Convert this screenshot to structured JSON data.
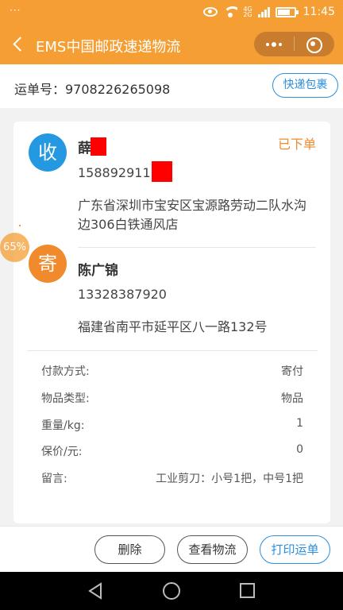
{
  "status_bar": {
    "dots": "···",
    "net_top": "4G",
    "net_bottom": "2G",
    "time": "11:45"
  },
  "titlebar": {
    "title": "EMS中国邮政速递物流"
  },
  "waybill": {
    "text": "运单号：9708226265098",
    "button": "快递包裹"
  },
  "receiver": {
    "avatar": "收",
    "name": "薛",
    "phone": "158892911",
    "address": "广东省深圳市宝安区宝源路劳动二队水沟边306白铁通风店",
    "status": "已下单"
  },
  "sender": {
    "avatar": "寄",
    "name": "陈广锦",
    "phone": "13328387920",
    "address": "福建省南平市延平区八一路132号"
  },
  "details": [
    {
      "label": "付款方式:",
      "value": "寄付"
    },
    {
      "label": "物品类型:",
      "value": "物品"
    },
    {
      "label": "重量/kg:",
      "value": "1"
    },
    {
      "label": "保价/元:",
      "value": "0"
    },
    {
      "label": "留言:",
      "value": "工业剪刀：小号1把，中号1把"
    }
  ],
  "progress_bubble": "65%",
  "actions": {
    "delete": "删除",
    "track": "查看物流",
    "print": "打印运单"
  },
  "colors": {
    "accent": "#f59e34",
    "link_blue": "#2b8fde",
    "receiver_avatar": "#2498e0",
    "sender_avatar": "#f08a2c",
    "redaction": "#ff0000"
  }
}
